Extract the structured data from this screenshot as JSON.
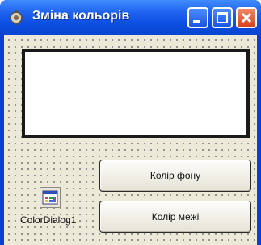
{
  "window": {
    "title": "Зміна кольорів",
    "icon": "form-app-icon",
    "controls": [
      "minimize-icon",
      "maximize-icon",
      "close-icon"
    ],
    "titlebar_color": "#1f63ef",
    "close_color": "#d8421c"
  },
  "form": {
    "background": "#ece9d8",
    "shape_border_color": "#1a1a1a",
    "shape_fill_color": "#ffffff"
  },
  "buttons": {
    "background_color": "Колір фону",
    "border_color": "Колір межі"
  },
  "component": {
    "label": "ColorDialog1",
    "icon": "color-dialog-icon"
  }
}
